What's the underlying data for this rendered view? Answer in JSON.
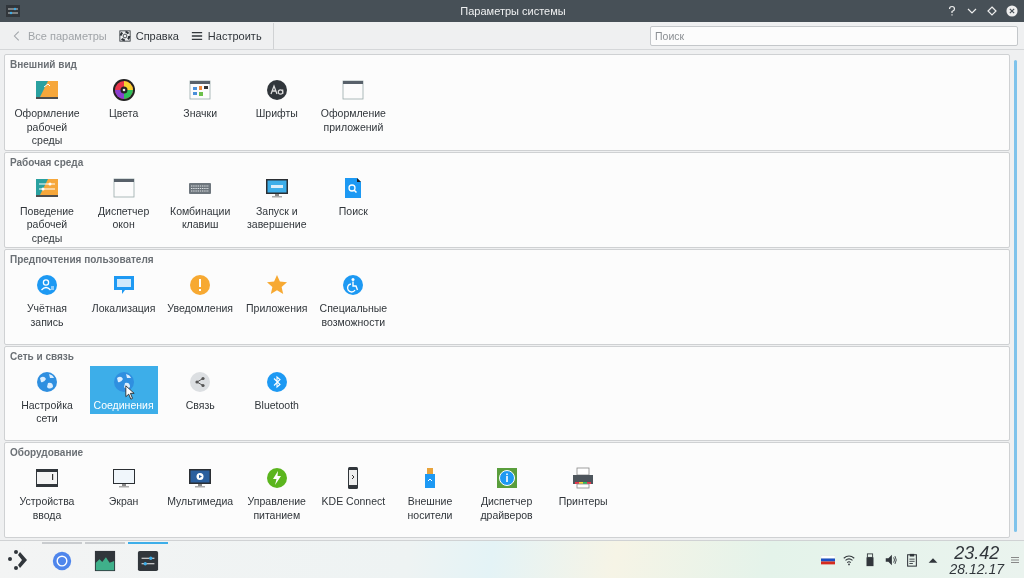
{
  "window": {
    "title": "Параметры системы"
  },
  "toolbar": {
    "back": {
      "label": "Все параметры",
      "disabled": true
    },
    "buttons": [
      "Справка",
      "Настроить"
    ],
    "search": {
      "placeholder": "Поиск"
    }
  },
  "sections": [
    {
      "title": "Внешний вид",
      "items": [
        {
          "label": "Оформление рабочей среды",
          "selected": false
        },
        {
          "label": "Цвета",
          "selected": false
        },
        {
          "label": "Значки",
          "selected": false
        },
        {
          "label": "Шрифты",
          "selected": false
        },
        {
          "label": "Оформление приложений",
          "selected": false
        }
      ]
    },
    {
      "title": "Рабочая среда",
      "items": [
        {
          "label": "Поведение рабочей среды",
          "selected": false
        },
        {
          "label": "Диспетчер окон",
          "selected": false
        },
        {
          "label": "Комбинации клавиш",
          "selected": false
        },
        {
          "label": "Запуск и завершение",
          "selected": false
        },
        {
          "label": "Поиск",
          "selected": false
        }
      ]
    },
    {
      "title": "Предпочтения пользователя",
      "items": [
        {
          "label": "Учётная запись",
          "selected": false
        },
        {
          "label": "Локализация",
          "selected": false
        },
        {
          "label": "Уведомления",
          "selected": false
        },
        {
          "label": "Приложения",
          "selected": false
        },
        {
          "label": "Специальные возможности",
          "selected": false
        }
      ]
    },
    {
      "title": "Сеть и связь",
      "items": [
        {
          "label": "Настройка сети",
          "selected": false
        },
        {
          "label": "Соединения",
          "selected": true
        },
        {
          "label": "Связь",
          "selected": false
        },
        {
          "label": "Bluetooth",
          "selected": false
        }
      ]
    },
    {
      "title": "Оборудование",
      "items": [
        {
          "label": "Устройства ввода",
          "selected": false
        },
        {
          "label": "Экран",
          "selected": false
        },
        {
          "label": "Мультимедиа",
          "selected": false
        },
        {
          "label": "Управление питанием",
          "selected": false
        },
        {
          "label": "KDE Connect",
          "selected": false
        },
        {
          "label": "Внешние носители",
          "selected": false
        },
        {
          "label": "Диспетчер драйверов",
          "selected": false
        },
        {
          "label": "Принтеры",
          "selected": false
        }
      ]
    }
  ],
  "taskbar": {
    "tasks": [
      {
        "selected": false
      },
      {
        "selected": false
      },
      {
        "selected": true
      }
    ],
    "clock": {
      "time": "23.42",
      "date": "28.12.17"
    }
  }
}
